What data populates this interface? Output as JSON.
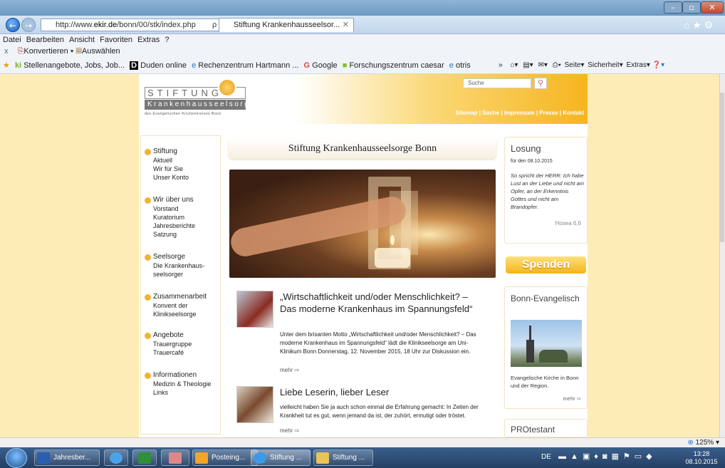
{
  "browser": {
    "tab_title": "Stiftung Krankenhausseelsor...",
    "url_prefix": "http://www.",
    "url_domain": "ekir.de",
    "url_path": "/bonn/00/stk/index.php",
    "menu": [
      "Datei",
      "Bearbeiten",
      "Ansicht",
      "Favoriten",
      "Extras",
      "?"
    ],
    "cmd": {
      "close": "x",
      "convert": "Konvertieren",
      "select": "Auswählen"
    },
    "favorites": [
      "Stellenangebote, Jobs, Job...",
      "Duden online",
      "Rechenzentrum Hartmann ...",
      "Google",
      "Forschungszentrum caesar",
      "otris"
    ],
    "toolbar_right": [
      "Seite",
      "Sicherheit",
      "Extras"
    ]
  },
  "site": {
    "logo_title": "STIFTUNG",
    "logo_sub": "Krankenhausseelsorge",
    "logo_tag": "des Evangelischen Kirchenkreises Bonn",
    "search_placeholder": "Suche",
    "toplinks": "Sitemap | Suche | Impressum | Presse | Kontakt"
  },
  "nav": [
    {
      "head": "Stiftung",
      "items": [
        "Aktuell",
        "Wir für Sie",
        "Unser Konto"
      ]
    },
    {
      "head": "Wir über uns",
      "items": [
        "Vorstand",
        "Kuratorium",
        "Jahresberichte",
        "Satzung"
      ]
    },
    {
      "head": "Seelsorge",
      "items": [
        "Die Krankenhaus-",
        "seelsorger"
      ]
    },
    {
      "head": "Zusammenarbeit",
      "items": [
        "Konvent der",
        "Klinikseelsorge"
      ]
    },
    {
      "head": "Angebote",
      "items": [
        "Trauergruppe",
        "Trauercafé"
      ]
    },
    {
      "head": "Informationen",
      "items": [
        "Medizin & Theologie",
        "Links"
      ]
    }
  ],
  "main": {
    "title": "Stiftung Krankenhausseelsorge Bonn",
    "article1": {
      "title": "„Wirtschaftlichkeit und/oder Menschlichkeit? – Das moderne Krankenhaus im Spannungsfeld“",
      "body": "Unter dem brisanten Motto „Wirtschaftlichkeit und/oder Menschlichkeit? – Das moderne Krankenhaus im Spannungsfeld“ lädt die Klinikseelsorge am Uni-Klinikum Bonn Donnerstag, 12. November 2015, 18 Uhr zur Diskussion ein.",
      "more": "mehr ⇨"
    },
    "article2": {
      "title": "Liebe Leserin, lieber Leser",
      "body": "vielleicht haben Sie ja auch schon einmal die Erfahrung gemacht: In Zeiten der Krankheit tut es gut, wenn jemand da ist, der zuhört, ermutigt oder tröstet.",
      "more": "mehr ⇨"
    }
  },
  "right": {
    "losung_title": "Losung",
    "losung_date": "für den 08.10.2015",
    "losung_text": "So spricht der HERR: Ich habe Lust an der Liebe und nicht am Opfer, an der Erkenntnis Gottes und nicht am Brandopfer.",
    "losung_ref": "Hosea 6,6",
    "spenden": "Spenden",
    "bonn_title": "Bonn-Evangelisch",
    "bonn_text": "Evangelische Kirche in Bonn und der Region.",
    "bonn_more": "mehr ⇨",
    "protestant": "PROtestant"
  },
  "status": {
    "zoom": "125%"
  },
  "taskbar": {
    "items": [
      "Jahresber...",
      "Posteing...",
      "Stiftung ...",
      "Stiftung ..."
    ],
    "lang": "DE",
    "time": "13:28",
    "date": "08.10.2015"
  }
}
